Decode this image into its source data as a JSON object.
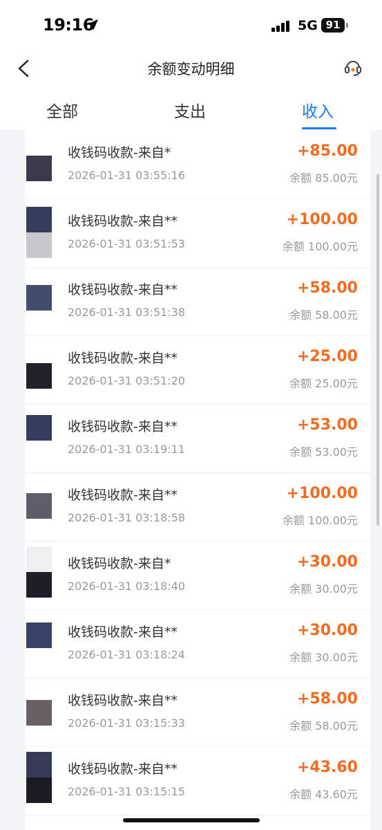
{
  "status_bar": {
    "time": "19:16",
    "network": "5G",
    "battery": "91"
  },
  "nav": {
    "title": "余额变动明细"
  },
  "tabs": [
    {
      "label": "全部",
      "active": false
    },
    {
      "label": "支出",
      "active": false
    },
    {
      "label": "收入",
      "active": true
    }
  ],
  "colors": {
    "accent": "#1677ff",
    "amount": "#f26b21"
  },
  "rows": [
    {
      "title": "收钱码收款-来自*",
      "time": "2026-01-31 03:55:16",
      "amount": "+85.00",
      "balance": "余额 85.00元"
    },
    {
      "title": "收钱码收款-来自**",
      "time": "2026-01-31 03:51:53",
      "amount": "+100.00",
      "balance": "余额 100.00元"
    },
    {
      "title": "收钱码收款-来自**",
      "time": "2026-01-31 03:51:38",
      "amount": "+58.00",
      "balance": "余额 58.00元"
    },
    {
      "title": "收钱码收款-来自**",
      "time": "2026-01-31 03:51:20",
      "amount": "+25.00",
      "balance": "余额 25.00元"
    },
    {
      "title": "收钱码收款-来自**",
      "time": "2026-01-31 03:19:11",
      "amount": "+53.00",
      "balance": "余额 53.00元"
    },
    {
      "title": "收钱码收款-来自**",
      "time": "2026-01-31 03:18:58",
      "amount": "+100.00",
      "balance": "余额 100.00元"
    },
    {
      "title": "收钱码收款-来自*",
      "time": "2026-01-31 03:18:40",
      "amount": "+30.00",
      "balance": "余额 30.00元"
    },
    {
      "title": "收钱码收款-来自**",
      "time": "2026-01-31 03:18:24",
      "amount": "+30.00",
      "balance": "余额 30.00元"
    },
    {
      "title": "收钱码收款-来自**",
      "time": "2026-01-31 03:15:33",
      "amount": "+58.00",
      "balance": "余额 58.00元"
    },
    {
      "title": "收钱码收款-来自**",
      "time": "2026-01-31 03:15:15",
      "amount": "+43.60",
      "balance": "余额 43.60元"
    }
  ]
}
